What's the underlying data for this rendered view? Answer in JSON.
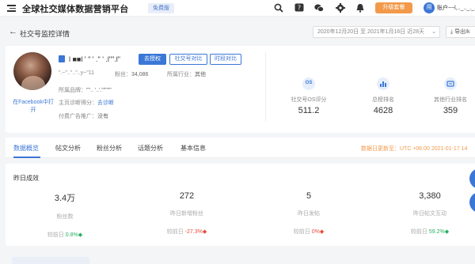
{
  "header": {
    "title": "全球社交媒体数据营销平台",
    "free_badge": "免费版",
    "upgrade": "升级套餐",
    "avatar_initial": "用",
    "account": "账户~~l,.._.._._.."
  },
  "subheader": {
    "back": "←",
    "title": "社交号监控详情",
    "date_range": "2020年12月20日 至 2021年1月16日 近28天",
    "export": "导出Ik"
  },
  "profile": {
    "handle": "l ■■l ' \" ' .\" ' .l\"\".l\"",
    "buttons": {
      "auth": "去授权",
      "compare": "社交号对比",
      "period": "时段对比"
    },
    "id_label": "\".~\"..\"..\"..y~\"11",
    "fans_label": "粉丝：",
    "fans_value": "34,086",
    "industry_label": "所属行业：",
    "industry_value": "其他",
    "brand_label": "所属品牌：",
    "brand_value": "\"\".. '..'.\"\"\"\"\"",
    "diagnosis_label": "主页诊断得分：",
    "diagnosis_link": "去诊断",
    "ads_label": "付费广告推广：",
    "ads_value": "没有",
    "facebook_link": "在Facebook中打开",
    "stats": [
      {
        "label": "社交号OS评分",
        "value": "511.2",
        "icon": "os-score-icon"
      },
      {
        "label": "总榜排名",
        "value": "4628",
        "icon": "bar-chart-icon"
      },
      {
        "label": "其他行业排名",
        "value": "359",
        "icon": "industry-icon"
      }
    ]
  },
  "tabs": {
    "items": [
      "数据概览",
      "帖文分析",
      "粉丝分析",
      "话题分析",
      "基本信息"
    ],
    "update_time": "数据日更新至：UTC +06:00 2021-01-17 14"
  },
  "yesterday": {
    "title": "昨日成效",
    "compare_label": "较前日",
    "metrics": [
      {
        "value": "3.4万",
        "label": "粉丝数",
        "change": "0.8%",
        "dir": "up"
      },
      {
        "value": "272",
        "label": "昨日新增粉丝",
        "change": "-27.3%",
        "dir": "down"
      },
      {
        "value": "5",
        "label": "昨日发帖",
        "change": "0%",
        "dir": "down"
      },
      {
        "value": "3,380",
        "label": "昨日帖文互动",
        "change": "59.2%",
        "dir": "up"
      }
    ]
  },
  "colors": {
    "primary": "#3b77d6",
    "accent": "#f2994a",
    "up": "#27ae60",
    "down": "#e74c3c"
  }
}
